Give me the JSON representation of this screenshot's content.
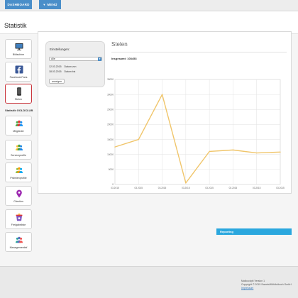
{
  "header": {
    "dashboard_label": "DASHBOARD",
    "menu_label": "MENÜ"
  },
  "page": {
    "title": "Statistik"
  },
  "sidebar": {
    "items": [
      {
        "label": "Bildschirm",
        "icon": "monitor-icon",
        "active": false
      },
      {
        "label": "Facebook Fans",
        "icon": "facebook-icon",
        "active": false
      },
      {
        "label": "Stelen",
        "icon": "tablet-icon",
        "active": true
      }
    ],
    "section_label": "Statistik GOLDCLUB",
    "section_items": [
      {
        "label": "Mitglieder",
        "icon": "members-icon"
      },
      {
        "label": "Serviceprofile",
        "icon": "service-profile-icon"
      },
      {
        "label": "Prämienprofile",
        "icon": "premium-profile-icon"
      },
      {
        "label": "Clientins",
        "icon": "location-pin-icon"
      },
      {
        "label": "Freigabeliste",
        "icon": "release-list-icon"
      },
      {
        "label": "Managementinf",
        "icon": "management-icon"
      }
    ]
  },
  "settings": {
    "header": "Einstellungen:",
    "select_value": "Alle",
    "date_from": "12.03.2015",
    "date_from_label": "Datum von",
    "date_to": "18.03.2015",
    "date_to_label": "Datum bis",
    "submit_label": "anzeigen"
  },
  "chart_panel": {
    "title": "Stelen",
    "summary": "Insgesamt: 103453"
  },
  "reporting": {
    "label": "Reporting"
  },
  "footer": {
    "version": "MallcockpIt Version 1",
    "copyright": "Copyright © 2015 SweetsWithHeibuch GmbH",
    "imprint": "Impressum"
  },
  "colors": {
    "accent": "#4a8ec9",
    "active_border": "#c9343b",
    "line": "#f0c56a",
    "reporting": "#2aa7de"
  },
  "chart_data": {
    "type": "line",
    "categories": [
      "03.2015",
      "03.2015",
      "03.2015",
      "03.2015",
      "03.2015",
      "03.2015",
      "03.2015",
      "03.2015"
    ],
    "values": [
      12500,
      15000,
      30000,
      500,
      11000,
      11500,
      10500,
      10800
    ],
    "yticks": [
      0,
      5000,
      10000,
      15000,
      20000,
      25000,
      30000,
      35000
    ],
    "ylim": [
      0,
      35000
    ],
    "grid": true
  }
}
